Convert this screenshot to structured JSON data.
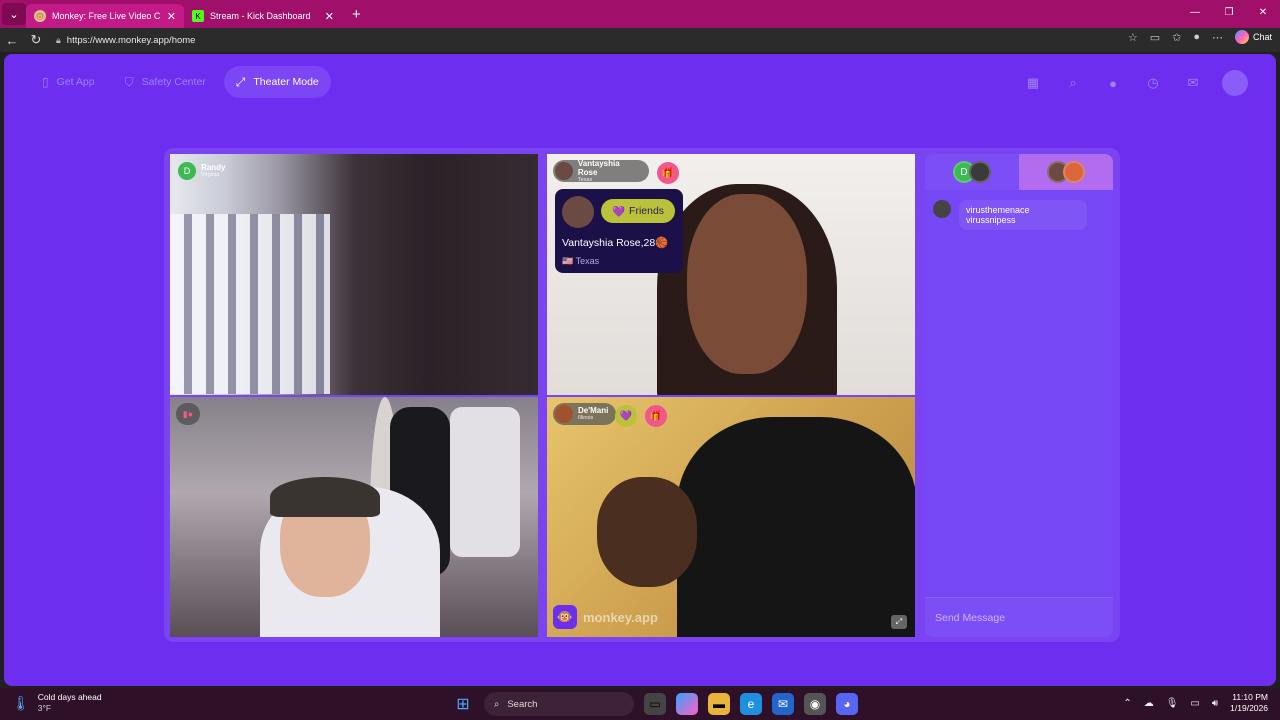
{
  "browser": {
    "tabs": [
      {
        "title": "Monkey: Free Live Video Chat",
        "active": true
      },
      {
        "title": "Stream - Kick Dashboard",
        "active": false
      }
    ],
    "url": "https://www.monkey.app/home",
    "copilot_label": "Chat"
  },
  "topnav": {
    "get_app": "Get App",
    "safety_center": "Safety Center",
    "theater_mode": "Theater Mode"
  },
  "tiles": {
    "randy": {
      "initial": "D",
      "name": "Randy",
      "location": "Virginia"
    },
    "vantayshia": {
      "name": "Vantayshia Rose",
      "location": "Texas"
    },
    "demani": {
      "name": "De'Mani",
      "location": "Illinois"
    }
  },
  "profile_card": {
    "friends_label": "Friends",
    "full_name": "Vantayshia Rose,28",
    "full_name_emoji": "🏀",
    "state": "Texas",
    "flag": "🇺🇸"
  },
  "brand": {
    "name": "monkey.app"
  },
  "chat": {
    "tab_a_initial": "D",
    "message": "virusthemenace virussnipess",
    "send_placeholder": "Send Message"
  },
  "taskbar": {
    "weather_title": "Cold days ahead",
    "weather_temp": "3°F",
    "search_label": "Search",
    "time": "11:10 PM",
    "date": "1/19/2026"
  },
  "colors": {
    "page_bg": "#6d2ef0",
    "accent_lime": "#b9c23a",
    "accent_pink": "#f0568f",
    "tab_bar": "#a0106a"
  }
}
